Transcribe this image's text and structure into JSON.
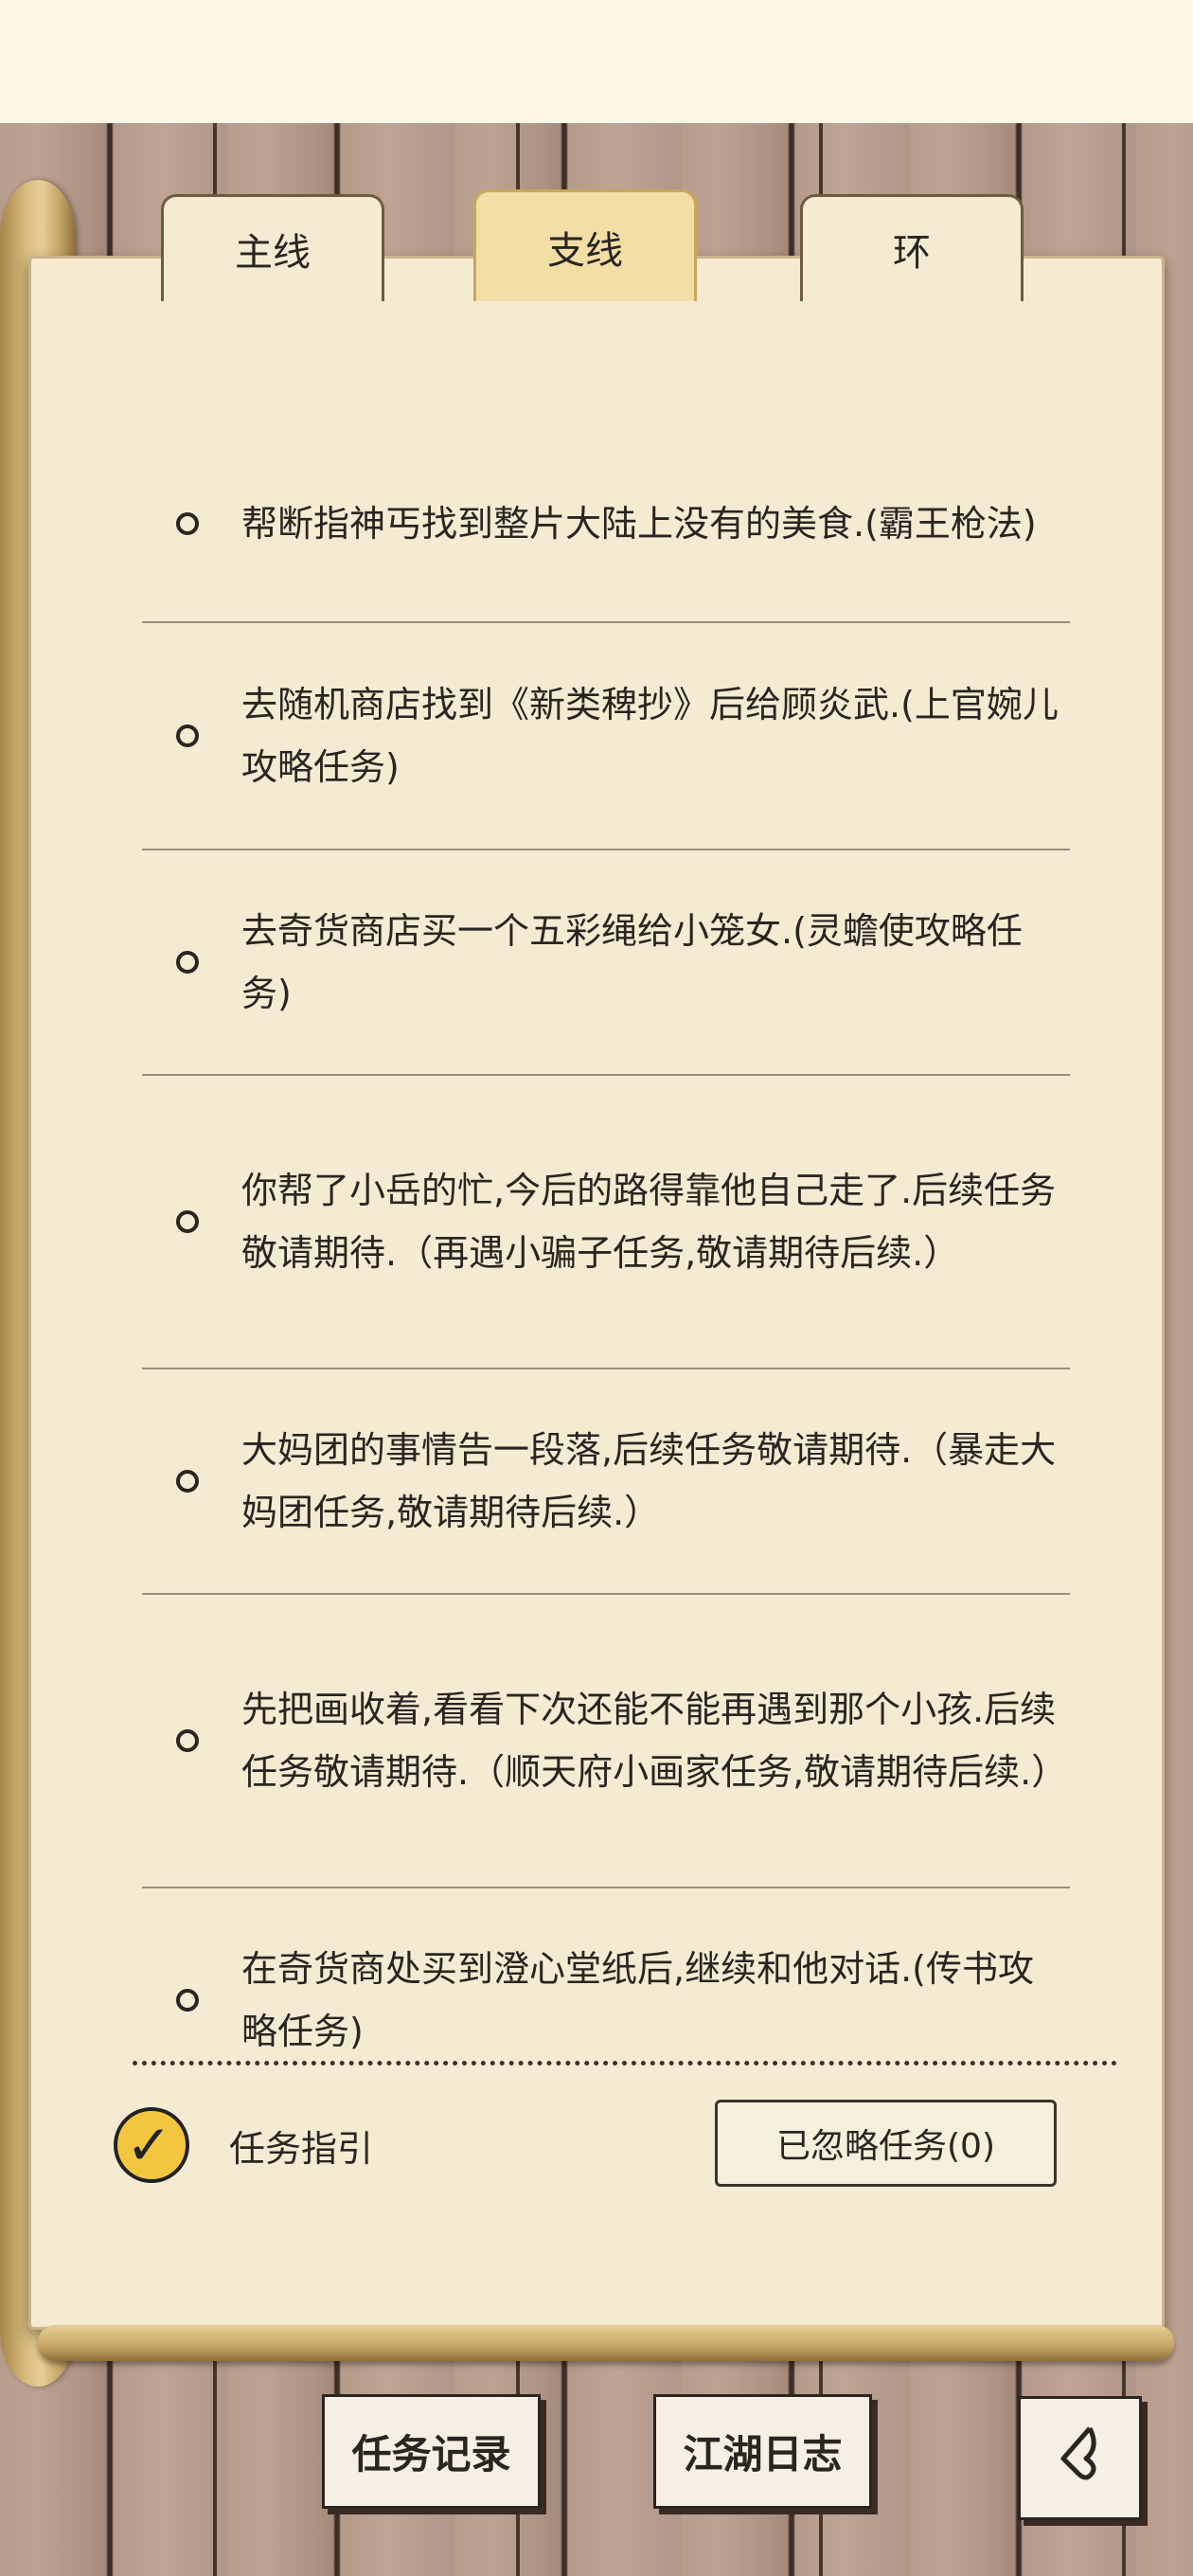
{
  "tabs": [
    {
      "label": "主线",
      "active": false
    },
    {
      "label": "支线",
      "active": true
    },
    {
      "label": "环",
      "active": false
    }
  ],
  "tasks": [
    {
      "text": "帮断指神丐找到整片大陆上没有的美食.(霸王枪法)"
    },
    {
      "text": "去随机商店找到《新类稗抄》后给顾炎武.(上官婉儿攻略任务)"
    },
    {
      "text": "去奇货商店买一个五彩绳给小笼女.(灵蟾使攻略任务)"
    },
    {
      "text": "你帮了小岳的忙,今后的路得靠他自己走了.后续任务敬请期待.（再遇小骗子任务,敬请期待后续.）"
    },
    {
      "text": "大妈团的事情告一段落,后续任务敬请期待.（暴走大妈团任务,敬请期待后续.）"
    },
    {
      "text": "先把画收着,看看下次还能不能再遇到那个小孩.后续任务敬请期待.（顺天府小画家任务,敬请期待后续.）"
    },
    {
      "text": "在奇货商处买到澄心堂纸后,继续和他对话.(传书攻略任务)"
    }
  ],
  "footer": {
    "guide_label": "任务指引",
    "guide_checked": true,
    "ignored_button": "已忽略任务(0)"
  },
  "bottom_nav": {
    "record_label": "任务记录",
    "journal_label": "江湖日志",
    "back_icon": "back-arrow-icon"
  }
}
